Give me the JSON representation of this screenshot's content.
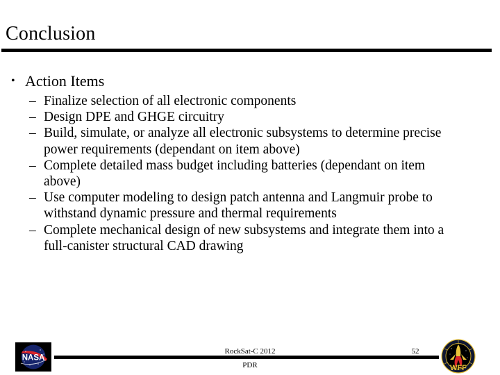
{
  "slide": {
    "title": "Conclusion",
    "page_number": "52",
    "body": {
      "bullet_marker": "•",
      "dash_marker": "–",
      "items": [
        {
          "level": 1,
          "text": "Action Items"
        }
      ],
      "subitems": [
        {
          "text": "Finalize selection of all electronic components"
        },
        {
          "text": "Design DPE and GHGE circuitry"
        },
        {
          "text": "Build, simulate, or analyze all electronic subsystems to determine precise power requirements (dependant on item above)"
        },
        {
          "text": "Complete detailed mass budget including batteries (dependant on item above)"
        },
        {
          "text": "Use computer modeling to design patch antenna and Langmuir probe to withstand dynamic pressure and thermal requirements"
        },
        {
          "text": "Complete mechanical design of new subsystems and integrate them into a full-canister structural CAD drawing"
        }
      ]
    },
    "footer": {
      "project": "RockSat-C 2012",
      "review": "PDR"
    },
    "logos": {
      "left": {
        "name": "nasa-logo",
        "wordmark": "NASA",
        "circle_color": "#1b2a6b",
        "background_color": "#000000",
        "swoosh_color": "#d9252a",
        "text_color": "#ffffff"
      },
      "right": {
        "name": "wff-logo",
        "wordmark": "WFF",
        "ring_color": "#141c3a",
        "accent_color": "#e8c23a",
        "flame_color": "#d9252a",
        "background_color": "#000000"
      }
    },
    "colors": {
      "text": "#000000",
      "background": "#ffffff",
      "rule": "#000000"
    }
  }
}
